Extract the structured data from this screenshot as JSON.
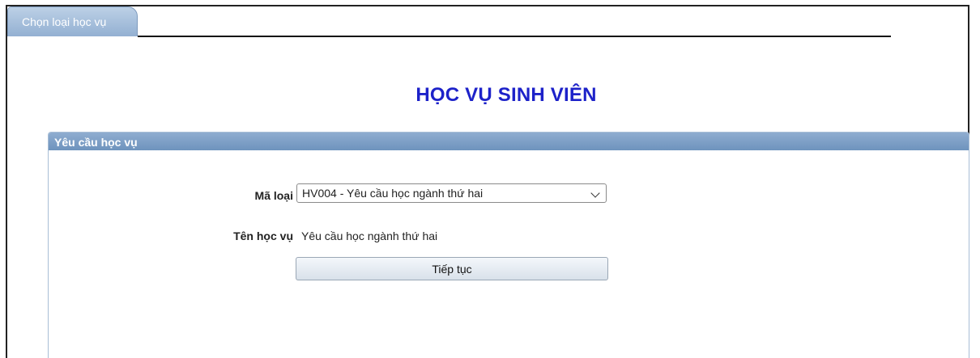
{
  "tab": {
    "label": "Chọn loại học vụ"
  },
  "page": {
    "title": "HỌC VỤ SINH VIÊN"
  },
  "panel": {
    "header": "Yêu cầu học vụ",
    "code_label": "Mã loại",
    "code_value": "HV004 - Yêu cầu học ngành thứ hai",
    "name_label": "Tên học vụ",
    "name_value": "Yêu cầu học ngành thứ hai",
    "continue_label": "Tiếp tục"
  },
  "colors": {
    "title": "#1d22c9",
    "header_bg": "#7b9cc4",
    "tab_bg": "#a8c0dc"
  }
}
